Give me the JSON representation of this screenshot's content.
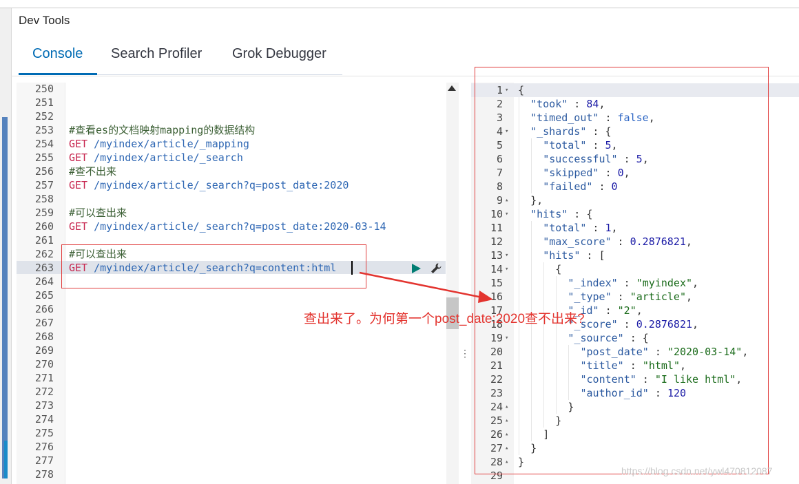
{
  "app": {
    "title": "Dev Tools"
  },
  "tabs": [
    {
      "label": "Console",
      "active": true
    },
    {
      "label": "Search Profiler",
      "active": false
    },
    {
      "label": "Grok Debugger",
      "active": false
    }
  ],
  "request_editor": {
    "lines": [
      {
        "n": "250",
        "t": "",
        "k": "plain"
      },
      {
        "n": "251",
        "t": "",
        "k": "plain"
      },
      {
        "n": "252",
        "t": "",
        "k": "plain"
      },
      {
        "n": "253",
        "t": "#查看es的文档映射mapping的数据结构",
        "k": "comment"
      },
      {
        "n": "254",
        "m": "GET",
        "p": " /myindex/article/_mapping",
        "k": "req"
      },
      {
        "n": "255",
        "m": "GET",
        "p": " /myindex/article/_search",
        "k": "req"
      },
      {
        "n": "256",
        "t": "#查不出来",
        "k": "comment"
      },
      {
        "n": "257",
        "m": "GET",
        "p": " /myindex/article/_search?q=post_date:2020",
        "k": "req"
      },
      {
        "n": "258",
        "t": "",
        "k": "plain"
      },
      {
        "n": "259",
        "t": "#可以查出来",
        "k": "comment"
      },
      {
        "n": "260",
        "m": "GET",
        "p": " /myindex/article/_search?q=post_date:2020-03-14",
        "k": "req"
      },
      {
        "n": "261",
        "t": "",
        "k": "plain"
      },
      {
        "n": "262",
        "t": "#可以查出来",
        "k": "comment"
      },
      {
        "n": "263",
        "m": "GET",
        "p": " /myindex/article/_search?q=content:html",
        "k": "req"
      },
      {
        "n": "264",
        "t": "",
        "k": "plain"
      },
      {
        "n": "265",
        "t": "",
        "k": "plain"
      },
      {
        "n": "266",
        "t": "",
        "k": "plain"
      },
      {
        "n": "267",
        "t": "",
        "k": "plain"
      },
      {
        "n": "268",
        "t": "",
        "k": "plain"
      },
      {
        "n": "269",
        "t": "",
        "k": "plain"
      },
      {
        "n": "270",
        "t": "",
        "k": "plain"
      },
      {
        "n": "271",
        "t": "",
        "k": "plain"
      },
      {
        "n": "272",
        "t": "",
        "k": "plain"
      },
      {
        "n": "273",
        "t": "",
        "k": "plain"
      },
      {
        "n": "274",
        "t": "",
        "k": "plain"
      },
      {
        "n": "275",
        "t": "",
        "k": "plain"
      },
      {
        "n": "276",
        "t": "",
        "k": "plain"
      },
      {
        "n": "277",
        "t": "",
        "k": "plain"
      },
      {
        "n": "278",
        "t": "",
        "k": "plain"
      }
    ],
    "run_icon": "play-icon",
    "settings_icon": "wrench-icon"
  },
  "response": {
    "lines": [
      {
        "n": "1",
        "f": "▾",
        "i": 0,
        "parts": [
          [
            "p",
            "{"
          ]
        ]
      },
      {
        "n": "2",
        "f": "",
        "i": 1,
        "parts": [
          [
            "k",
            "\"took\""
          ],
          [
            "p",
            " : "
          ],
          [
            "num",
            "84"
          ],
          [
            "p",
            ","
          ]
        ]
      },
      {
        "n": "3",
        "f": "",
        "i": 1,
        "parts": [
          [
            "k",
            "\"timed_out\""
          ],
          [
            "p",
            " : "
          ],
          [
            "bool",
            "false"
          ],
          [
            "p",
            ","
          ]
        ]
      },
      {
        "n": "4",
        "f": "▾",
        "i": 1,
        "parts": [
          [
            "k",
            "\"_shards\""
          ],
          [
            "p",
            " : {"
          ]
        ]
      },
      {
        "n": "5",
        "f": "",
        "i": 2,
        "parts": [
          [
            "k",
            "\"total\""
          ],
          [
            "p",
            " : "
          ],
          [
            "num",
            "5"
          ],
          [
            "p",
            ","
          ]
        ]
      },
      {
        "n": "6",
        "f": "",
        "i": 2,
        "parts": [
          [
            "k",
            "\"successful\""
          ],
          [
            "p",
            " : "
          ],
          [
            "num",
            "5"
          ],
          [
            "p",
            ","
          ]
        ]
      },
      {
        "n": "7",
        "f": "",
        "i": 2,
        "parts": [
          [
            "k",
            "\"skipped\""
          ],
          [
            "p",
            " : "
          ],
          [
            "num",
            "0"
          ],
          [
            "p",
            ","
          ]
        ]
      },
      {
        "n": "8",
        "f": "",
        "i": 2,
        "parts": [
          [
            "k",
            "\"failed\""
          ],
          [
            "p",
            " : "
          ],
          [
            "num",
            "0"
          ]
        ]
      },
      {
        "n": "9",
        "f": "▴",
        "i": 1,
        "parts": [
          [
            "p",
            "},"
          ]
        ]
      },
      {
        "n": "10",
        "f": "▾",
        "i": 1,
        "parts": [
          [
            "k",
            "\"hits\""
          ],
          [
            "p",
            " : {"
          ]
        ]
      },
      {
        "n": "11",
        "f": "",
        "i": 2,
        "parts": [
          [
            "k",
            "\"total\""
          ],
          [
            "p",
            " : "
          ],
          [
            "num",
            "1"
          ],
          [
            "p",
            ","
          ]
        ]
      },
      {
        "n": "12",
        "f": "",
        "i": 2,
        "parts": [
          [
            "k",
            "\"max_score\""
          ],
          [
            "p",
            " : "
          ],
          [
            "num",
            "0.2876821"
          ],
          [
            "p",
            ","
          ]
        ]
      },
      {
        "n": "13",
        "f": "▾",
        "i": 2,
        "parts": [
          [
            "k",
            "\"hits\""
          ],
          [
            "p",
            " : ["
          ]
        ]
      },
      {
        "n": "14",
        "f": "▾",
        "i": 3,
        "parts": [
          [
            "p",
            "{"
          ]
        ]
      },
      {
        "n": "15",
        "f": "",
        "i": 4,
        "parts": [
          [
            "k",
            "\"_index\""
          ],
          [
            "p",
            " : "
          ],
          [
            "str",
            "\"myindex\""
          ],
          [
            "p",
            ","
          ]
        ]
      },
      {
        "n": "16",
        "f": "",
        "i": 4,
        "parts": [
          [
            "k",
            "\"_type\""
          ],
          [
            "p",
            " : "
          ],
          [
            "str",
            "\"article\""
          ],
          [
            "p",
            ","
          ]
        ]
      },
      {
        "n": "17",
        "f": "",
        "i": 4,
        "parts": [
          [
            "k",
            "\"_id\""
          ],
          [
            "p",
            " : "
          ],
          [
            "str",
            "\"2\""
          ],
          [
            "p",
            ","
          ]
        ]
      },
      {
        "n": "18",
        "f": "",
        "i": 4,
        "parts": [
          [
            "k",
            "\"_score\""
          ],
          [
            "p",
            " : "
          ],
          [
            "num",
            "0.2876821"
          ],
          [
            "p",
            ","
          ]
        ]
      },
      {
        "n": "19",
        "f": "▾",
        "i": 4,
        "parts": [
          [
            "k",
            "\"_source\""
          ],
          [
            "p",
            " : {"
          ]
        ]
      },
      {
        "n": "20",
        "f": "",
        "i": 5,
        "parts": [
          [
            "k",
            "\"post_date\""
          ],
          [
            "p",
            " : "
          ],
          [
            "str",
            "\"2020-03-14\""
          ],
          [
            "p",
            ","
          ]
        ]
      },
      {
        "n": "21",
        "f": "",
        "i": 5,
        "parts": [
          [
            "k",
            "\"title\""
          ],
          [
            "p",
            " : "
          ],
          [
            "str",
            "\"html\""
          ],
          [
            "p",
            ","
          ]
        ]
      },
      {
        "n": "22",
        "f": "",
        "i": 5,
        "parts": [
          [
            "k",
            "\"content\""
          ],
          [
            "p",
            " : "
          ],
          [
            "str",
            "\"I like html\""
          ],
          [
            "p",
            ","
          ]
        ]
      },
      {
        "n": "23",
        "f": "",
        "i": 5,
        "parts": [
          [
            "k",
            "\"author_id\""
          ],
          [
            "p",
            " : "
          ],
          [
            "num",
            "120"
          ]
        ]
      },
      {
        "n": "24",
        "f": "▴",
        "i": 4,
        "parts": [
          [
            "p",
            "}"
          ]
        ]
      },
      {
        "n": "25",
        "f": "▴",
        "i": 3,
        "parts": [
          [
            "p",
            "}"
          ]
        ]
      },
      {
        "n": "26",
        "f": "▴",
        "i": 2,
        "parts": [
          [
            "p",
            "]"
          ]
        ]
      },
      {
        "n": "27",
        "f": "▴",
        "i": 1,
        "parts": [
          [
            "p",
            "}"
          ]
        ]
      },
      {
        "n": "28",
        "f": "▴",
        "i": 0,
        "parts": [
          [
            "p",
            "}"
          ]
        ]
      },
      {
        "n": "29",
        "f": "",
        "i": 0,
        "parts": []
      }
    ]
  },
  "annotation": {
    "text": "查出来了。为何第一个post_date:2020查不出来?",
    "color": "#e3342f"
  },
  "watermark": "https://blog.csdn.net/ywl470812087",
  "colors": {
    "accent": "#006bb4",
    "method": "#c7254e",
    "path": "#2d66b3",
    "comment": "#3b5f34"
  }
}
